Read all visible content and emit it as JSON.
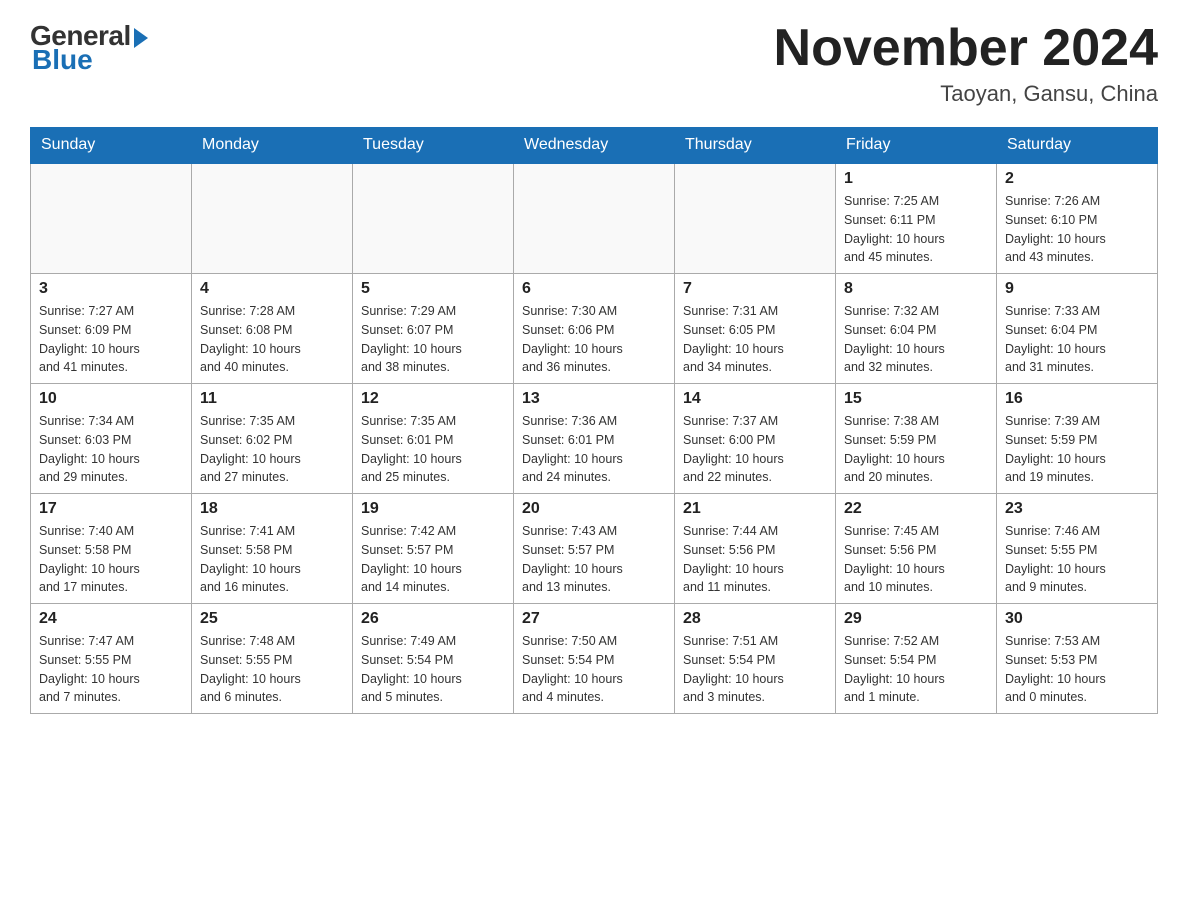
{
  "header": {
    "logo_general": "General",
    "logo_blue": "Blue",
    "month_title": "November 2024",
    "location": "Taoyan, Gansu, China"
  },
  "weekdays": [
    "Sunday",
    "Monday",
    "Tuesday",
    "Wednesday",
    "Thursday",
    "Friday",
    "Saturday"
  ],
  "weeks": [
    [
      {
        "day": "",
        "info": ""
      },
      {
        "day": "",
        "info": ""
      },
      {
        "day": "",
        "info": ""
      },
      {
        "day": "",
        "info": ""
      },
      {
        "day": "",
        "info": ""
      },
      {
        "day": "1",
        "info": "Sunrise: 7:25 AM\nSunset: 6:11 PM\nDaylight: 10 hours\nand 45 minutes."
      },
      {
        "day": "2",
        "info": "Sunrise: 7:26 AM\nSunset: 6:10 PM\nDaylight: 10 hours\nand 43 minutes."
      }
    ],
    [
      {
        "day": "3",
        "info": "Sunrise: 7:27 AM\nSunset: 6:09 PM\nDaylight: 10 hours\nand 41 minutes."
      },
      {
        "day": "4",
        "info": "Sunrise: 7:28 AM\nSunset: 6:08 PM\nDaylight: 10 hours\nand 40 minutes."
      },
      {
        "day": "5",
        "info": "Sunrise: 7:29 AM\nSunset: 6:07 PM\nDaylight: 10 hours\nand 38 minutes."
      },
      {
        "day": "6",
        "info": "Sunrise: 7:30 AM\nSunset: 6:06 PM\nDaylight: 10 hours\nand 36 minutes."
      },
      {
        "day": "7",
        "info": "Sunrise: 7:31 AM\nSunset: 6:05 PM\nDaylight: 10 hours\nand 34 minutes."
      },
      {
        "day": "8",
        "info": "Sunrise: 7:32 AM\nSunset: 6:04 PM\nDaylight: 10 hours\nand 32 minutes."
      },
      {
        "day": "9",
        "info": "Sunrise: 7:33 AM\nSunset: 6:04 PM\nDaylight: 10 hours\nand 31 minutes."
      }
    ],
    [
      {
        "day": "10",
        "info": "Sunrise: 7:34 AM\nSunset: 6:03 PM\nDaylight: 10 hours\nand 29 minutes."
      },
      {
        "day": "11",
        "info": "Sunrise: 7:35 AM\nSunset: 6:02 PM\nDaylight: 10 hours\nand 27 minutes."
      },
      {
        "day": "12",
        "info": "Sunrise: 7:35 AM\nSunset: 6:01 PM\nDaylight: 10 hours\nand 25 minutes."
      },
      {
        "day": "13",
        "info": "Sunrise: 7:36 AM\nSunset: 6:01 PM\nDaylight: 10 hours\nand 24 minutes."
      },
      {
        "day": "14",
        "info": "Sunrise: 7:37 AM\nSunset: 6:00 PM\nDaylight: 10 hours\nand 22 minutes."
      },
      {
        "day": "15",
        "info": "Sunrise: 7:38 AM\nSunset: 5:59 PM\nDaylight: 10 hours\nand 20 minutes."
      },
      {
        "day": "16",
        "info": "Sunrise: 7:39 AM\nSunset: 5:59 PM\nDaylight: 10 hours\nand 19 minutes."
      }
    ],
    [
      {
        "day": "17",
        "info": "Sunrise: 7:40 AM\nSunset: 5:58 PM\nDaylight: 10 hours\nand 17 minutes."
      },
      {
        "day": "18",
        "info": "Sunrise: 7:41 AM\nSunset: 5:58 PM\nDaylight: 10 hours\nand 16 minutes."
      },
      {
        "day": "19",
        "info": "Sunrise: 7:42 AM\nSunset: 5:57 PM\nDaylight: 10 hours\nand 14 minutes."
      },
      {
        "day": "20",
        "info": "Sunrise: 7:43 AM\nSunset: 5:57 PM\nDaylight: 10 hours\nand 13 minutes."
      },
      {
        "day": "21",
        "info": "Sunrise: 7:44 AM\nSunset: 5:56 PM\nDaylight: 10 hours\nand 11 minutes."
      },
      {
        "day": "22",
        "info": "Sunrise: 7:45 AM\nSunset: 5:56 PM\nDaylight: 10 hours\nand 10 minutes."
      },
      {
        "day": "23",
        "info": "Sunrise: 7:46 AM\nSunset: 5:55 PM\nDaylight: 10 hours\nand 9 minutes."
      }
    ],
    [
      {
        "day": "24",
        "info": "Sunrise: 7:47 AM\nSunset: 5:55 PM\nDaylight: 10 hours\nand 7 minutes."
      },
      {
        "day": "25",
        "info": "Sunrise: 7:48 AM\nSunset: 5:55 PM\nDaylight: 10 hours\nand 6 minutes."
      },
      {
        "day": "26",
        "info": "Sunrise: 7:49 AM\nSunset: 5:54 PM\nDaylight: 10 hours\nand 5 minutes."
      },
      {
        "day": "27",
        "info": "Sunrise: 7:50 AM\nSunset: 5:54 PM\nDaylight: 10 hours\nand 4 minutes."
      },
      {
        "day": "28",
        "info": "Sunrise: 7:51 AM\nSunset: 5:54 PM\nDaylight: 10 hours\nand 3 minutes."
      },
      {
        "day": "29",
        "info": "Sunrise: 7:52 AM\nSunset: 5:54 PM\nDaylight: 10 hours\nand 1 minute."
      },
      {
        "day": "30",
        "info": "Sunrise: 7:53 AM\nSunset: 5:53 PM\nDaylight: 10 hours\nand 0 minutes."
      }
    ]
  ]
}
